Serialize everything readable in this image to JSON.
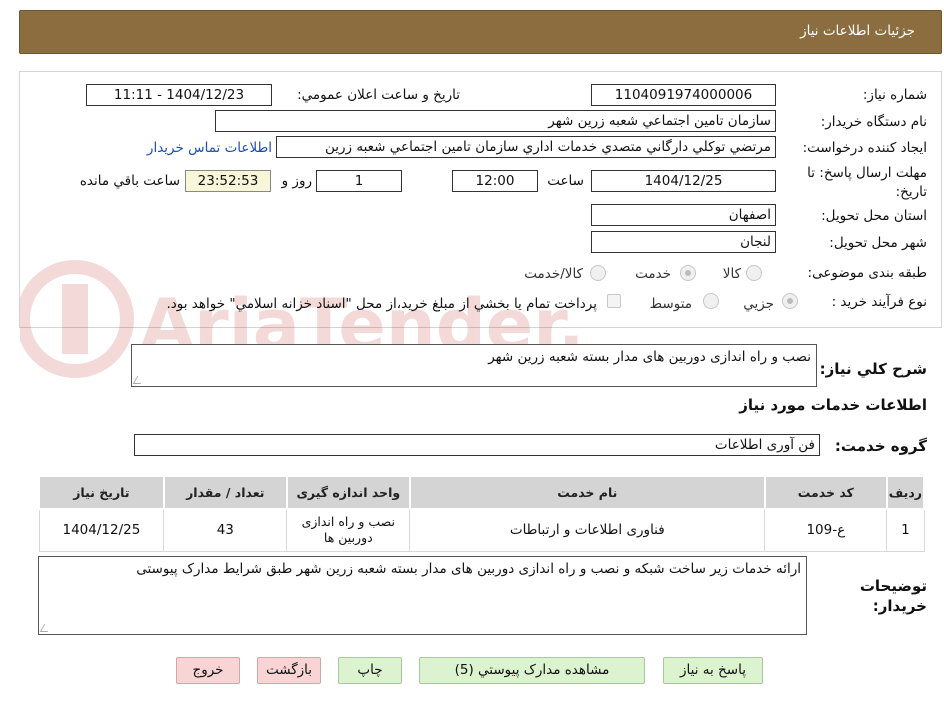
{
  "header": {
    "title": "جزئیات اطلاعات نیاز"
  },
  "fields": {
    "need_number_label": "شماره نیاز:",
    "need_number": "1104091974000006",
    "announce_label": "تاریخ و ساعت اعلان عمومي:",
    "announce_value": "1404/12/23 - 11:11",
    "buyer_org_label": "نام دستگاه خريدار:",
    "buyer_org": "سازمان تامين اجتماعي شعبه زرين شهر",
    "requester_label": "ايجاد کننده درخواست:",
    "requester": "مرتضي توکلي دارگاني متصدي خدمات اداري  سازمان تامين اجتماعي شعبه زرين",
    "contact_link": "اطلاعات تماس خريدار",
    "deadline_label": "مهلت ارسال پاسخ: تا تاریخ:",
    "deadline_date": "1404/12/25",
    "time_label": "ساعت",
    "deadline_time": "12:00",
    "days_value": "1",
    "days_label": "روز و",
    "remaining_value": "23:52:53",
    "remaining_label": "ساعت باقي مانده",
    "province_label": "استان محل تحويل:",
    "province": "اصفهان",
    "city_label": "شهر محل تحويل:",
    "city": "لنجان",
    "category_label": "طبقه بندی موضوعی:",
    "category_options": [
      "کالا",
      "خدمت",
      "کالا/خدمت"
    ],
    "category_selected": "خدمت",
    "process_label": "نوع فرآيند خريد :",
    "process_options": [
      "جزيي",
      "متوسط"
    ],
    "process_selected": "جزيي",
    "payment_note": "پرداخت تمام يا بخشي از مبلغ خريد،از محل \"اسناد خزانه اسلامي\" خواهد بود."
  },
  "watermark": {
    "text": "AriaTender.neT"
  },
  "summary": {
    "label": "شرح کلي نياز:",
    "value": "نصب و راه اندازی دوربین های مدار بسته شعبه زرین شهر"
  },
  "services": {
    "section_title": "اطلاعات خدمات مورد نياز",
    "group_label": "گروه خدمت:",
    "group_value": "فن آوری اطلاعات",
    "table": {
      "headers": [
        "رديف",
        "کد خدمت",
        "نام خدمت",
        "واحد اندازه گيری",
        "تعداد / مقدار",
        "تاريخ نياز"
      ],
      "rows": [
        [
          "1",
          "ع-109",
          "فناوری اطلاعات و ارتباطات",
          "نصب و راه اندازی دوربین ها",
          "43",
          "1404/12/25"
        ]
      ]
    }
  },
  "buyer_notes": {
    "label": "توضيحات خريدار:",
    "value": "ارائه خدمات زیر ساخت شبکه و نصب و راه اندازی دوربین های مدار بسته شعبه زرین شهر طبق شرایط مدارک پیوستی"
  },
  "buttons": {
    "reply": "پاسخ به نياز",
    "attachments": "مشاهده مدارک پيوستي (5)",
    "print": "چاپ",
    "back": "بازگشت",
    "exit": "خروج"
  }
}
